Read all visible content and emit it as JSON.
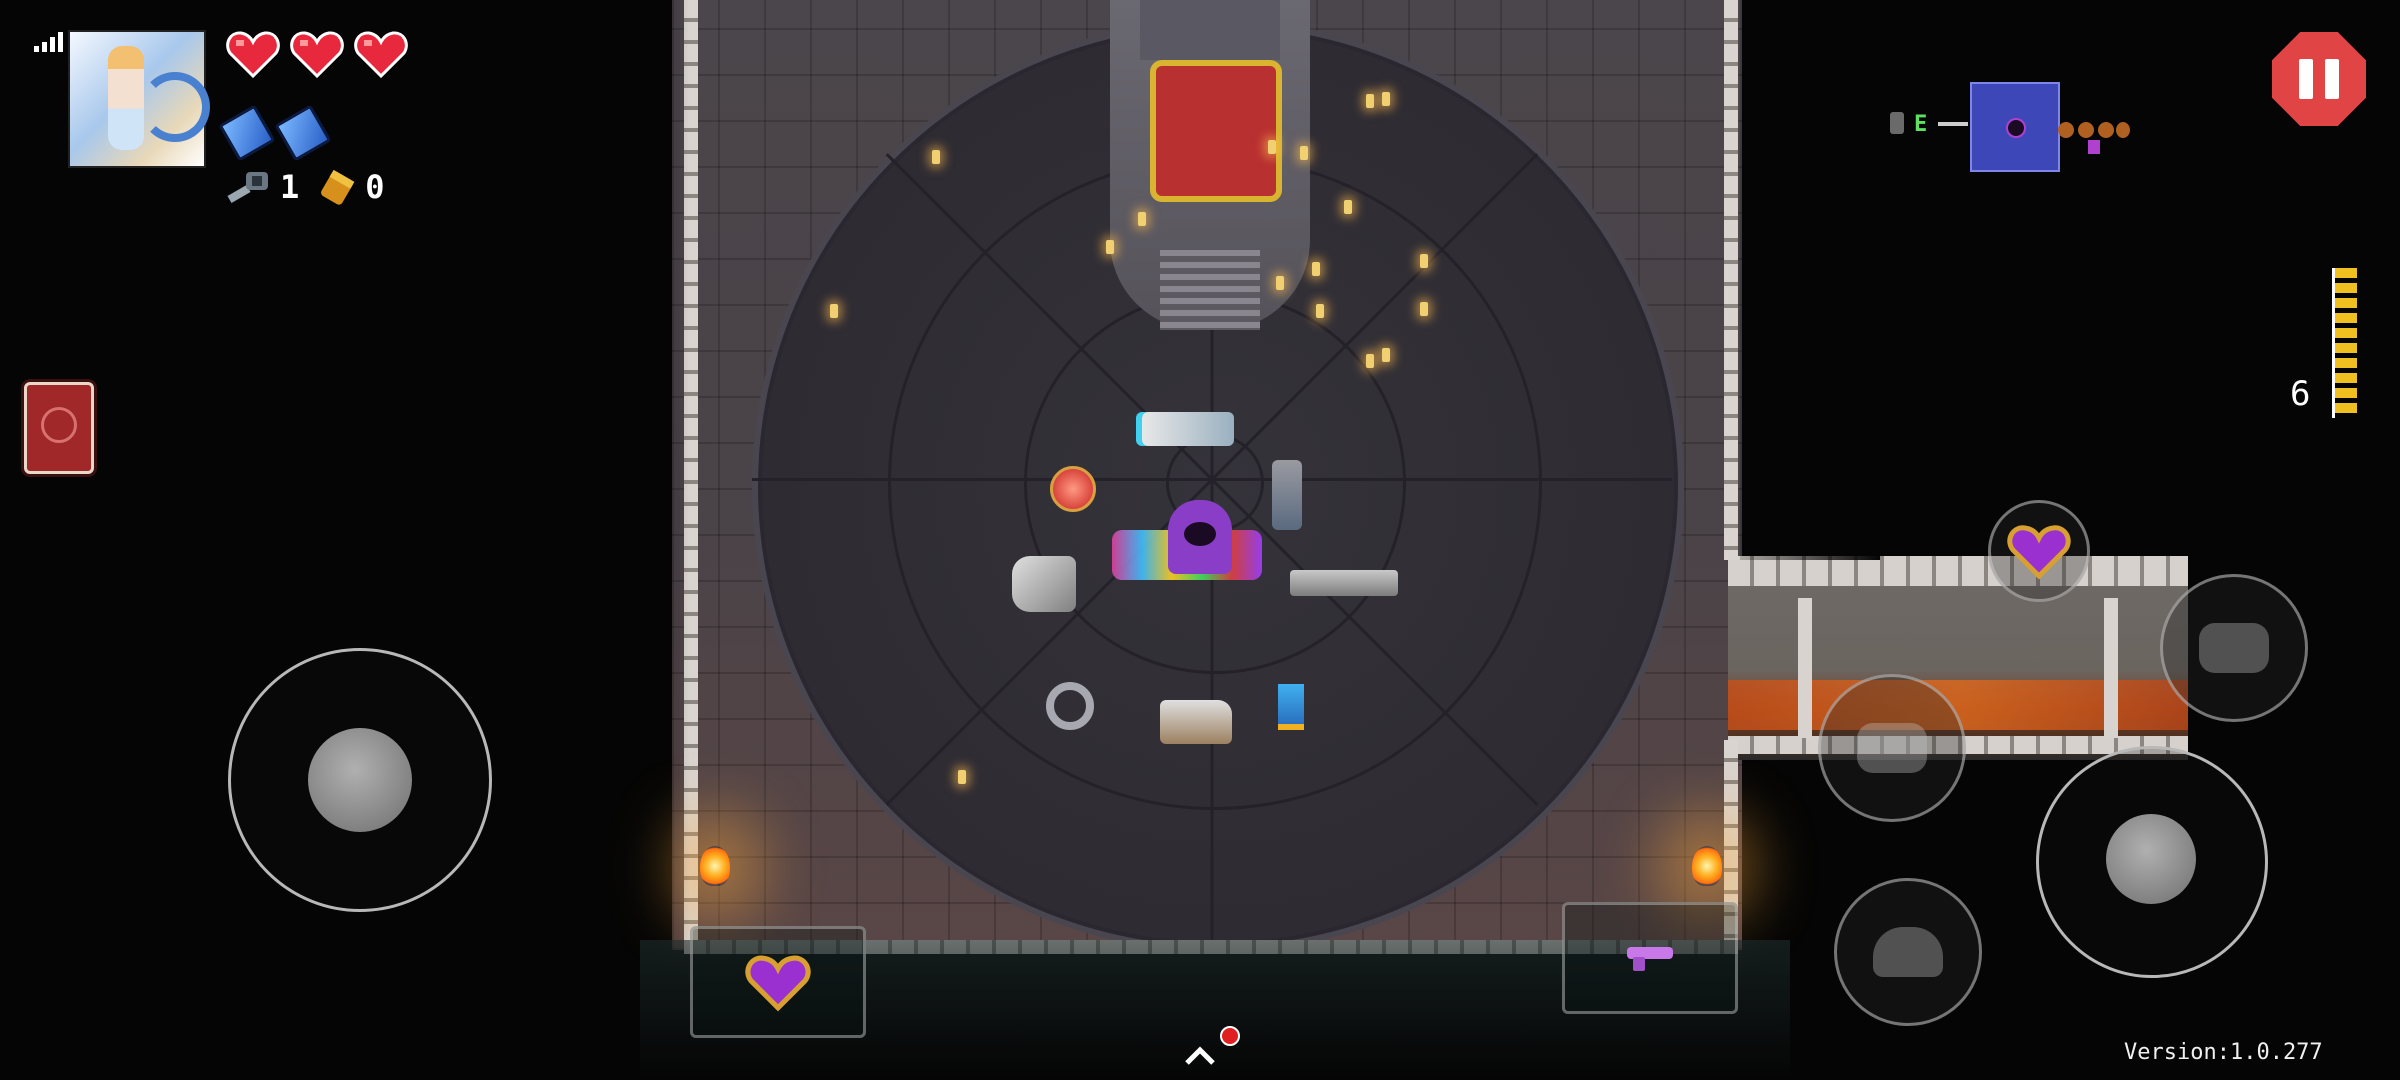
{
  "status_bar": {
    "signal_icon": "signal-bars-icon"
  },
  "player": {
    "avatar_icon": "player-avatar",
    "health": {
      "full_hearts": 3,
      "max_hearts": 3,
      "icon": "red-heart-icon",
      "color": "#e8283c"
    },
    "blanks": {
      "count": 2,
      "icon": "blank-icon",
      "color": "#4a8ef0"
    }
  },
  "resources": {
    "keys": {
      "icon": "key-icon",
      "count": "1"
    },
    "casings": {
      "icon": "shell-casing-icon",
      "count": "0"
    }
  },
  "active_item": {
    "icon": "red-book-icon"
  },
  "minimap": {
    "label": "E",
    "current_room_color": "#3e47b8"
  },
  "ammo": {
    "count": "6",
    "icon": "bullet-clip-icon",
    "color": "#f0c020"
  },
  "controls": {
    "pause": {
      "icon": "pause-icon",
      "color": "#e04444"
    },
    "move_joystick": {
      "icon": "joystick-icon"
    },
    "aim_joystick": {
      "icon": "joystick-icon"
    },
    "heart_button": {
      "icon": "purple-heart-icon"
    },
    "reload_button": {
      "icon": "reload-icon"
    },
    "blank_button": {
      "icon": "blank-burst-icon"
    },
    "dodge_button": {
      "icon": "dodge-roll-icon"
    },
    "item_slot_left": {
      "icon": "purple-heart-icon"
    },
    "item_slot_right": {
      "icon": "purple-gun-icon"
    },
    "expand_button": {
      "icon": "chevron-up-icon",
      "notification": true
    }
  },
  "room": {
    "name_icons": [
      "throne-icon",
      "hooded-merchant-icon",
      "torch-icon",
      "candle-icon"
    ],
    "floor_items": [
      "laser-rifle-icon",
      "red-orb-icon",
      "lantern-icon",
      "gauntlet-icon",
      "shotgun-icon",
      "ring-icon",
      "revolver-icon",
      "blue-card-icon"
    ]
  },
  "version_text": "Version:1.0.277"
}
